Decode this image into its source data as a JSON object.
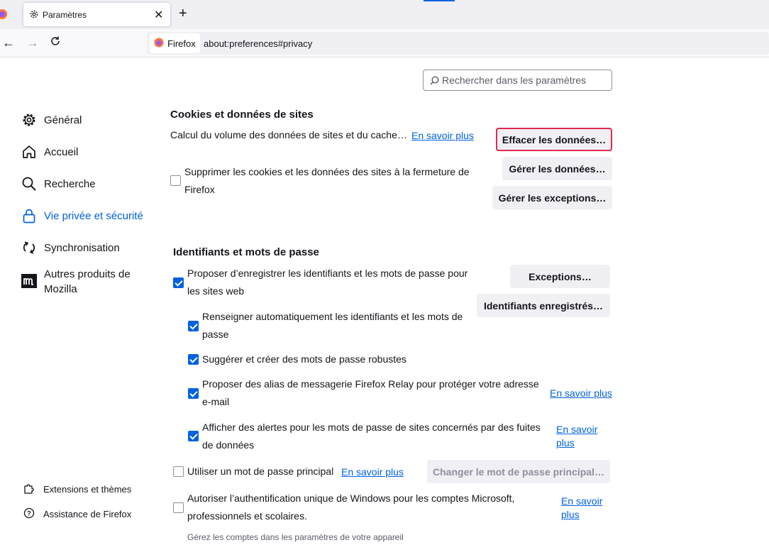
{
  "browser": {
    "tab_title": "Paramètres",
    "new_tab_label": "+",
    "close_tab_label": "✕",
    "identity_label": "Firefox",
    "url": "about:preferences#privacy"
  },
  "search": {
    "placeholder": "Rechercher dans les paramètres"
  },
  "sidebar": {
    "items": [
      {
        "label": "Général",
        "icon": "gear-icon"
      },
      {
        "label": "Accueil",
        "icon": "home-icon"
      },
      {
        "label": "Recherche",
        "icon": "search-icon"
      },
      {
        "label": "Vie privée et sécurité",
        "icon": "lock-icon",
        "active": true
      },
      {
        "label": "Synchronisation",
        "icon": "sync-icon"
      },
      {
        "label": "Autres produits de Mozilla",
        "icon": "mozilla-icon"
      }
    ],
    "footer": [
      {
        "label": "Extensions et thèmes",
        "icon": "puzzle-icon"
      },
      {
        "label": "Assistance de Firefox",
        "icon": "help-icon"
      }
    ]
  },
  "cookies": {
    "heading": "Cookies et données de sites",
    "status_text": "Calcul du volume des données de sites et du cache…",
    "learn_more": "En savoir plus",
    "clear_button": "Effacer les données…",
    "manage_button": "Gérer les données…",
    "exceptions_button": "Gérer les exceptions…",
    "delete_on_close_label": "Supprimer les cookies et les données des sites à la fermeture de Firefox",
    "delete_on_close_checked": false
  },
  "logins": {
    "heading": "Identifiants et mots de passe",
    "offer_save_label": "Proposer d’enregistrer les identifiants et les mots de passe pour les sites web",
    "offer_save_checked": true,
    "exceptions_button": "Exceptions…",
    "saved_logins_button": "Identifiants enregistrés…",
    "autofill_label": "Renseigner automatiquement les identifiants et les mots de passe",
    "autofill_checked": true,
    "suggest_label": "Suggérer et créer des mots de passe robustes",
    "suggest_checked": true,
    "relay_label": "Proposer des alias de messagerie Firefox Relay pour protéger votre adresse e-mail",
    "relay_checked": true,
    "relay_learn_more": "En savoir plus",
    "breach_label": "Afficher des alertes pour les mots de passe de sites concernés par des fuites de données",
    "breach_checked": true,
    "breach_learn_more": "En savoir plus",
    "primary_password_label": "Utiliser un mot de passe principal",
    "primary_password_checked": false,
    "primary_learn_more": "En savoir plus",
    "change_primary_button": "Changer le mot de passe principal…",
    "sso_label": "Autoriser l’authentification unique de Windows pour les comptes Microsoft, professionnels et scolaires.",
    "sso_checked": false,
    "sso_learn_more": "En savoir plus",
    "sso_note": "Gérez les comptes dans les paramètres de votre appareil"
  },
  "colors": {
    "accent": "#0061e0",
    "highlight_border": "#e22850"
  }
}
